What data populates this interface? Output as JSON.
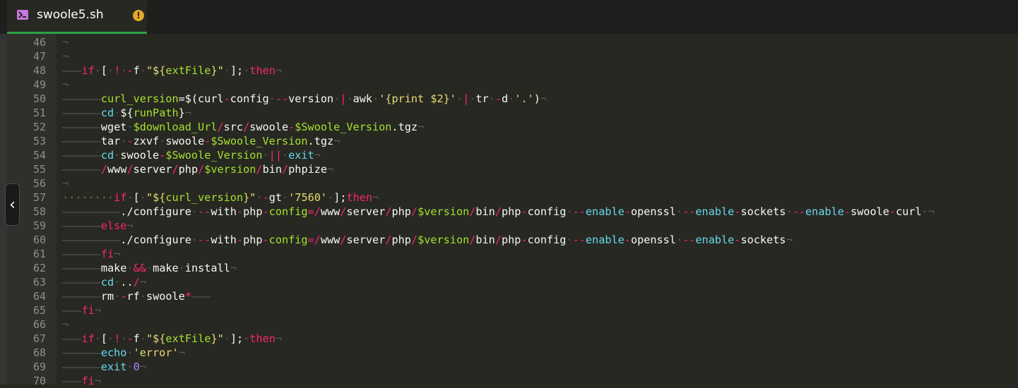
{
  "tab": {
    "title": "swoole5.sh",
    "warning": "!"
  },
  "collapse_button": "‹",
  "lines": [
    {
      "num": "46",
      "tokens": [
        [
          "inv",
          "¬"
        ]
      ]
    },
    {
      "num": "47",
      "tokens": [
        [
          "inv",
          "¬"
        ]
      ]
    },
    {
      "num": "48",
      "tokens": [
        [
          "inv",
          "———"
        ],
        [
          "kw",
          "if"
        ],
        [
          "inv",
          "·"
        ],
        [
          "txt",
          "["
        ],
        [
          "inv",
          "·"
        ],
        [
          "kw",
          "!"
        ],
        [
          "inv",
          "·"
        ],
        [
          "kw",
          "-"
        ],
        [
          "txt",
          "f"
        ],
        [
          "inv",
          "·"
        ],
        [
          "str",
          "\"${"
        ],
        [
          "var",
          "extFile"
        ],
        [
          "str",
          "}\""
        ],
        [
          "inv",
          "·"
        ],
        [
          "txt",
          "];"
        ],
        [
          "inv",
          "·"
        ],
        [
          "kw",
          "then"
        ],
        [
          "inv",
          "¬"
        ]
      ]
    },
    {
      "num": "49",
      "tokens": [
        [
          "inv",
          "¬"
        ]
      ]
    },
    {
      "num": "50",
      "tokens": [
        [
          "inv",
          "——————"
        ],
        [
          "var",
          "curl_version"
        ],
        [
          "txt",
          "=$(curl"
        ],
        [
          "kw",
          "-"
        ],
        [
          "txt",
          "config"
        ],
        [
          "inv",
          "·"
        ],
        [
          "kw",
          "--"
        ],
        [
          "txt",
          "version"
        ],
        [
          "inv",
          "·"
        ],
        [
          "kw",
          "|"
        ],
        [
          "inv",
          "·"
        ],
        [
          "txt",
          "awk"
        ],
        [
          "inv",
          "·"
        ],
        [
          "str",
          "'{print $2}'"
        ],
        [
          "inv",
          "·"
        ],
        [
          "kw",
          "|"
        ],
        [
          "inv",
          "·"
        ],
        [
          "txt",
          "tr"
        ],
        [
          "inv",
          "·"
        ],
        [
          "kw",
          "-"
        ],
        [
          "txt",
          "d"
        ],
        [
          "inv",
          "·"
        ],
        [
          "str",
          "'.'"
        ],
        [
          "txt",
          ")"
        ],
        [
          "inv",
          "¬"
        ]
      ]
    },
    {
      "num": "51",
      "tokens": [
        [
          "inv",
          "——————"
        ],
        [
          "fn",
          "cd"
        ],
        [
          "inv",
          "·"
        ],
        [
          "txt",
          "${"
        ],
        [
          "var",
          "runPath"
        ],
        [
          "txt",
          "}"
        ],
        [
          "inv",
          "¬"
        ]
      ]
    },
    {
      "num": "52",
      "tokens": [
        [
          "inv",
          "——————"
        ],
        [
          "txt",
          "wget"
        ],
        [
          "inv",
          "·"
        ],
        [
          "var",
          "$download_Url"
        ],
        [
          "kw",
          "/"
        ],
        [
          "txt",
          "src"
        ],
        [
          "kw",
          "/"
        ],
        [
          "txt",
          "swoole"
        ],
        [
          "kw",
          "-"
        ],
        [
          "var",
          "$Swoole_Version"
        ],
        [
          "txt",
          ".tgz"
        ],
        [
          "inv",
          "¬"
        ]
      ]
    },
    {
      "num": "53",
      "tokens": [
        [
          "inv",
          "——————"
        ],
        [
          "txt",
          "tar"
        ],
        [
          "inv",
          "·"
        ],
        [
          "kw",
          "-"
        ],
        [
          "txt",
          "zxvf"
        ],
        [
          "inv",
          "·"
        ],
        [
          "txt",
          "swoole"
        ],
        [
          "kw",
          "-"
        ],
        [
          "var",
          "$Swoole_Version"
        ],
        [
          "txt",
          ".tgz"
        ],
        [
          "inv",
          "¬"
        ]
      ]
    },
    {
      "num": "54",
      "tokens": [
        [
          "inv",
          "——————"
        ],
        [
          "fn",
          "cd"
        ],
        [
          "inv",
          "·"
        ],
        [
          "txt",
          "swoole"
        ],
        [
          "kw",
          "-"
        ],
        [
          "var",
          "$Swoole_Version"
        ],
        [
          "inv",
          "·"
        ],
        [
          "kw",
          "||"
        ],
        [
          "inv",
          "·"
        ],
        [
          "fn",
          "exit"
        ],
        [
          "inv",
          "¬"
        ]
      ]
    },
    {
      "num": "55",
      "tokens": [
        [
          "inv",
          "——————"
        ],
        [
          "kw",
          "/"
        ],
        [
          "txt",
          "www"
        ],
        [
          "kw",
          "/"
        ],
        [
          "txt",
          "server"
        ],
        [
          "kw",
          "/"
        ],
        [
          "txt",
          "php"
        ],
        [
          "kw",
          "/"
        ],
        [
          "var",
          "$version"
        ],
        [
          "kw",
          "/"
        ],
        [
          "txt",
          "bin"
        ],
        [
          "kw",
          "/"
        ],
        [
          "txt",
          "phpize"
        ],
        [
          "inv",
          "¬"
        ]
      ]
    },
    {
      "num": "56",
      "tokens": [
        [
          "inv",
          "¬"
        ]
      ]
    },
    {
      "num": "57",
      "tokens": [
        [
          "dot",
          "········"
        ],
        [
          "kw",
          "if"
        ],
        [
          "inv",
          "·"
        ],
        [
          "txt",
          "["
        ],
        [
          "inv",
          "·"
        ],
        [
          "str",
          "\"${"
        ],
        [
          "var",
          "curl_version"
        ],
        [
          "str",
          "}\""
        ],
        [
          "inv",
          "·"
        ],
        [
          "kw",
          "-"
        ],
        [
          "txt",
          "gt"
        ],
        [
          "inv",
          "·"
        ],
        [
          "str",
          "'7560'"
        ],
        [
          "inv",
          "·"
        ],
        [
          "txt",
          "];"
        ],
        [
          "kw",
          "then"
        ],
        [
          "inv",
          "¬"
        ]
      ]
    },
    {
      "num": "58",
      "tokens": [
        [
          "inv",
          "—————————"
        ],
        [
          "txt",
          "./configure"
        ],
        [
          "inv",
          "·"
        ],
        [
          "kw",
          "--"
        ],
        [
          "txt",
          "with"
        ],
        [
          "kw",
          "-"
        ],
        [
          "txt",
          "php"
        ],
        [
          "kw",
          "-"
        ],
        [
          "var",
          "config"
        ],
        [
          "kw",
          "="
        ],
        [
          "kw",
          "/"
        ],
        [
          "txt",
          "www"
        ],
        [
          "kw",
          "/"
        ],
        [
          "txt",
          "server"
        ],
        [
          "kw",
          "/"
        ],
        [
          "txt",
          "php"
        ],
        [
          "kw",
          "/"
        ],
        [
          "var",
          "$version"
        ],
        [
          "kw",
          "/"
        ],
        [
          "txt",
          "bin"
        ],
        [
          "kw",
          "/"
        ],
        [
          "txt",
          "php"
        ],
        [
          "kw",
          "-"
        ],
        [
          "txt",
          "config"
        ],
        [
          "inv",
          "·"
        ],
        [
          "kw",
          "--"
        ],
        [
          "fn",
          "enable"
        ],
        [
          "kw",
          "-"
        ],
        [
          "txt",
          "openssl"
        ],
        [
          "inv",
          "·"
        ],
        [
          "kw",
          "--"
        ],
        [
          "fn",
          "enable"
        ],
        [
          "kw",
          "-"
        ],
        [
          "txt",
          "sockets"
        ],
        [
          "inv",
          "·"
        ],
        [
          "kw",
          "--"
        ],
        [
          "fn",
          "enable"
        ],
        [
          "kw",
          "-"
        ],
        [
          "txt",
          "swoole"
        ],
        [
          "kw",
          "-"
        ],
        [
          "txt",
          "curl"
        ],
        [
          "inv",
          "·¬"
        ]
      ]
    },
    {
      "num": "59",
      "tokens": [
        [
          "inv",
          "——————"
        ],
        [
          "kw",
          "else"
        ],
        [
          "inv",
          "¬"
        ]
      ]
    },
    {
      "num": "60",
      "tokens": [
        [
          "inv",
          "—————————"
        ],
        [
          "txt",
          "./configure"
        ],
        [
          "inv",
          "·"
        ],
        [
          "kw",
          "--"
        ],
        [
          "txt",
          "with"
        ],
        [
          "kw",
          "-"
        ],
        [
          "txt",
          "php"
        ],
        [
          "kw",
          "-"
        ],
        [
          "var",
          "config"
        ],
        [
          "kw",
          "="
        ],
        [
          "kw",
          "/"
        ],
        [
          "txt",
          "www"
        ],
        [
          "kw",
          "/"
        ],
        [
          "txt",
          "server"
        ],
        [
          "kw",
          "/"
        ],
        [
          "txt",
          "php"
        ],
        [
          "kw",
          "/"
        ],
        [
          "var",
          "$version"
        ],
        [
          "kw",
          "/"
        ],
        [
          "txt",
          "bin"
        ],
        [
          "kw",
          "/"
        ],
        [
          "txt",
          "php"
        ],
        [
          "kw",
          "-"
        ],
        [
          "txt",
          "config"
        ],
        [
          "inv",
          "·"
        ],
        [
          "kw",
          "--"
        ],
        [
          "fn",
          "enable"
        ],
        [
          "kw",
          "-"
        ],
        [
          "txt",
          "openssl"
        ],
        [
          "inv",
          "·"
        ],
        [
          "kw",
          "--"
        ],
        [
          "fn",
          "enable"
        ],
        [
          "kw",
          "-"
        ],
        [
          "txt",
          "sockets"
        ],
        [
          "inv",
          "¬"
        ]
      ]
    },
    {
      "num": "61",
      "tokens": [
        [
          "inv",
          "——————"
        ],
        [
          "kw",
          "fi"
        ],
        [
          "inv",
          "¬"
        ]
      ]
    },
    {
      "num": "62",
      "tokens": [
        [
          "inv",
          "——————"
        ],
        [
          "txt",
          "make"
        ],
        [
          "inv",
          "·"
        ],
        [
          "kw",
          "&&"
        ],
        [
          "inv",
          "·"
        ],
        [
          "txt",
          "make"
        ],
        [
          "inv",
          "·"
        ],
        [
          "txt",
          "install"
        ],
        [
          "inv",
          "¬"
        ]
      ]
    },
    {
      "num": "63",
      "tokens": [
        [
          "inv",
          "——————"
        ],
        [
          "fn",
          "cd"
        ],
        [
          "inv",
          "·"
        ],
        [
          "txt",
          ".."
        ],
        [
          "kw",
          "/"
        ],
        [
          "inv",
          "¬"
        ]
      ]
    },
    {
      "num": "64",
      "tokens": [
        [
          "inv",
          "——————"
        ],
        [
          "txt",
          "rm"
        ],
        [
          "inv",
          "·"
        ],
        [
          "kw",
          "-"
        ],
        [
          "txt",
          "rf"
        ],
        [
          "inv",
          "·"
        ],
        [
          "txt",
          "swoole"
        ],
        [
          "kw",
          "*"
        ],
        [
          "inv",
          "———"
        ]
      ]
    },
    {
      "num": "65",
      "tokens": [
        [
          "inv",
          "———"
        ],
        [
          "kw",
          "fi"
        ],
        [
          "inv",
          "¬"
        ]
      ]
    },
    {
      "num": "66",
      "tokens": [
        [
          "inv",
          "¬"
        ]
      ]
    },
    {
      "num": "67",
      "tokens": [
        [
          "inv",
          "———"
        ],
        [
          "kw",
          "if"
        ],
        [
          "inv",
          "·"
        ],
        [
          "txt",
          "["
        ],
        [
          "inv",
          "·"
        ],
        [
          "kw",
          "!"
        ],
        [
          "inv",
          "·"
        ],
        [
          "kw",
          "-"
        ],
        [
          "txt",
          "f"
        ],
        [
          "inv",
          "·"
        ],
        [
          "str",
          "\"${"
        ],
        [
          "var",
          "extFile"
        ],
        [
          "str",
          "}\""
        ],
        [
          "inv",
          "·"
        ],
        [
          "txt",
          "];"
        ],
        [
          "inv",
          "·"
        ],
        [
          "kw",
          "then"
        ],
        [
          "inv",
          "¬"
        ]
      ]
    },
    {
      "num": "68",
      "tokens": [
        [
          "inv",
          "——————"
        ],
        [
          "fn",
          "echo"
        ],
        [
          "inv",
          "·"
        ],
        [
          "str",
          "'error'"
        ],
        [
          "inv",
          "¬"
        ]
      ]
    },
    {
      "num": "69",
      "tokens": [
        [
          "inv",
          "——————"
        ],
        [
          "fn",
          "exit"
        ],
        [
          "inv",
          "·"
        ],
        [
          "num",
          "0"
        ],
        [
          "inv",
          "¬"
        ]
      ]
    },
    {
      "num": "70",
      "tokens": [
        [
          "inv",
          "———"
        ],
        [
          "kw",
          "fi"
        ],
        [
          "inv",
          "¬"
        ]
      ]
    }
  ]
}
